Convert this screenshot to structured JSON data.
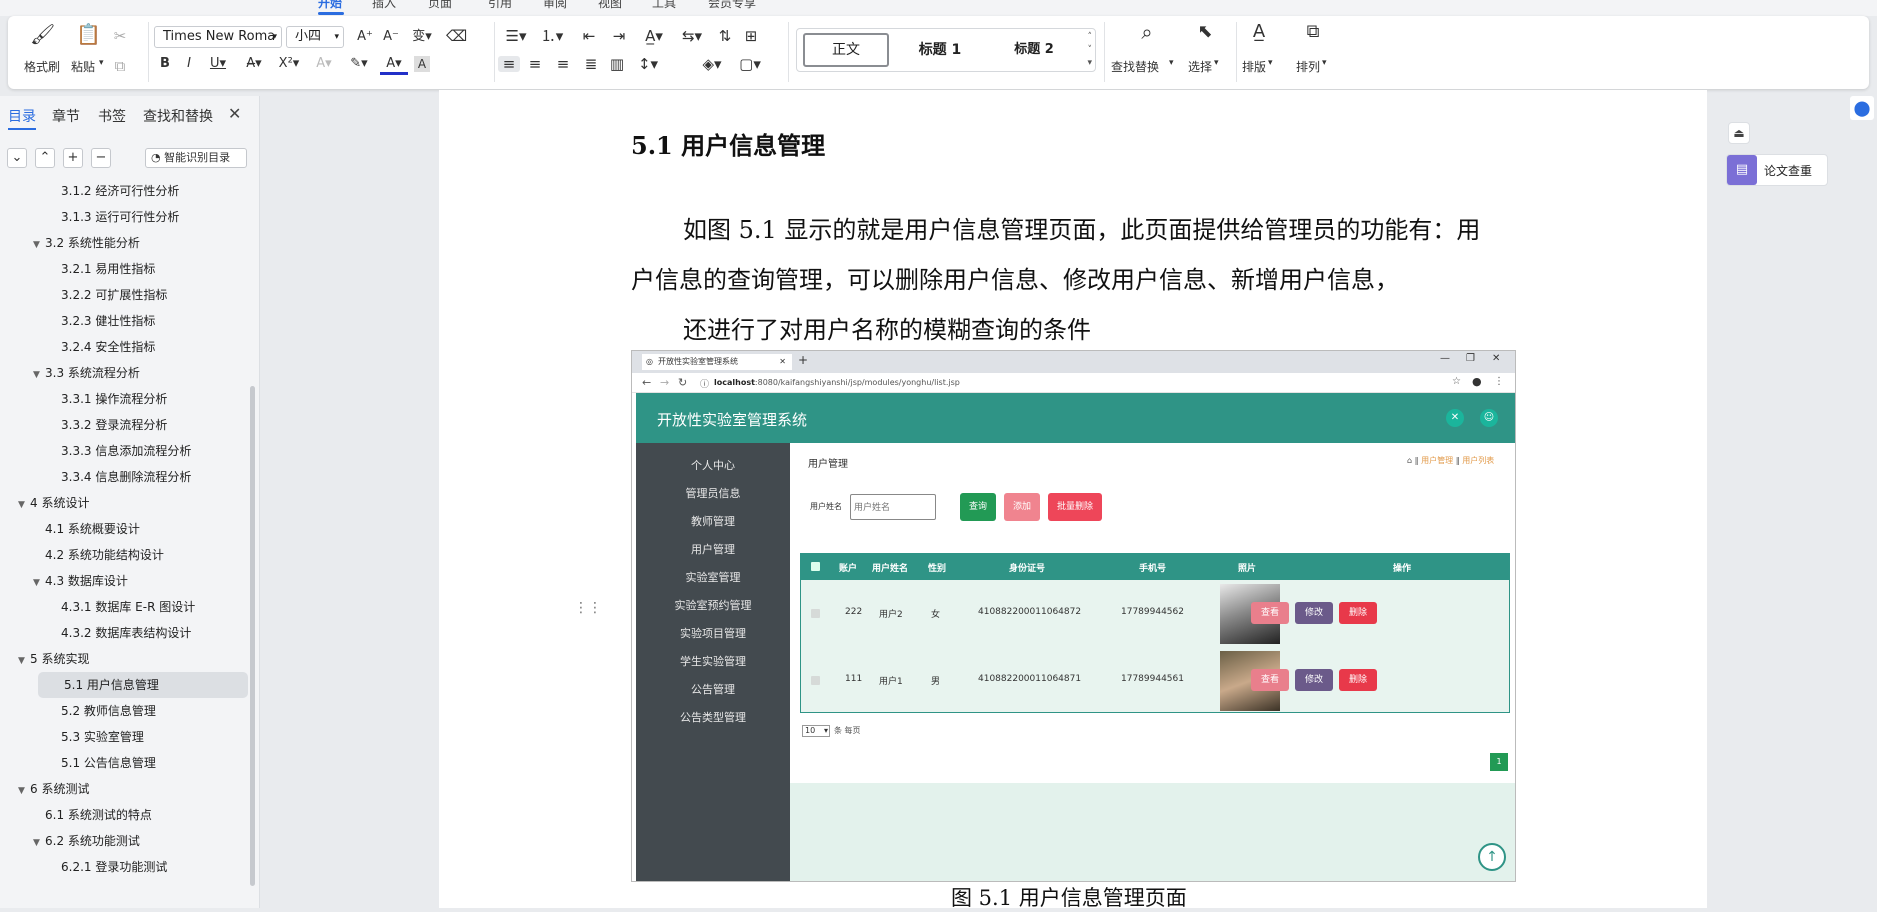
{
  "menu_tabs": [
    "开始",
    "插入",
    "页面",
    "引用",
    "审阅",
    "视图",
    "工具",
    "会员专享"
  ],
  "ribbon": {
    "format_painter": "格式刷",
    "paste": "粘贴",
    "font_name": "Times New Roma",
    "font_size": "小四",
    "style_normal": "正文",
    "style_h1": "标题 1",
    "style_h2": "标题 2",
    "find_replace": "查找替换",
    "select": "选择",
    "typeset": "排版",
    "arrange": "排列"
  },
  "sidebar": {
    "tabs": [
      "目录",
      "章节",
      "书签",
      "查找和替换"
    ],
    "smart_toc": "智能识别目录",
    "items": [
      {
        "label": "3.1.2 经济可行性分析",
        "level": 3,
        "arrow": ""
      },
      {
        "label": "3.1.3 运行可行性分析",
        "level": 3,
        "arrow": ""
      },
      {
        "label": "3.2 系统性能分析",
        "level": 2,
        "arrow": "▼"
      },
      {
        "label": "3.2.1 易用性指标",
        "level": 3,
        "arrow": ""
      },
      {
        "label": "3.2.2 可扩展性指标",
        "level": 3,
        "arrow": ""
      },
      {
        "label": "3.2.3 健壮性指标",
        "level": 3,
        "arrow": ""
      },
      {
        "label": "3.2.4 安全性指标",
        "level": 3,
        "arrow": ""
      },
      {
        "label": "3.3 系统流程分析",
        "level": 2,
        "arrow": "▼"
      },
      {
        "label": "3.3.1 操作流程分析",
        "level": 3,
        "arrow": ""
      },
      {
        "label": "3.3.2 登录流程分析",
        "level": 3,
        "arrow": ""
      },
      {
        "label": "3.3.3 信息添加流程分析",
        "level": 3,
        "arrow": ""
      },
      {
        "label": "3.3.4 信息删除流程分析",
        "level": 3,
        "arrow": ""
      },
      {
        "label": "4 系统设计",
        "level": 1,
        "arrow": "▼"
      },
      {
        "label": "4.1 系统概要设计",
        "level": 2,
        "arrow": ""
      },
      {
        "label": "4.2 系统功能结构设计",
        "level": 2,
        "arrow": ""
      },
      {
        "label": "4.3 数据库设计",
        "level": 2,
        "arrow": "▼"
      },
      {
        "label": "4.3.1 数据库 E-R 图设计",
        "level": 3,
        "arrow": ""
      },
      {
        "label": "4.3.2 数据库表结构设计",
        "level": 3,
        "arrow": ""
      },
      {
        "label": "5 系统实现",
        "level": 1,
        "arrow": "▼"
      },
      {
        "label": "5.1 用户信息管理",
        "level": 3,
        "arrow": "",
        "selected": true
      },
      {
        "label": "5.2 教师信息管理",
        "level": 3,
        "arrow": ""
      },
      {
        "label": "5.3 实验室管理",
        "level": 3,
        "arrow": ""
      },
      {
        "label": "5.1 公告信息管理",
        "level": 3,
        "arrow": ""
      },
      {
        "label": "6 系统测试",
        "level": 1,
        "arrow": "▼"
      },
      {
        "label": "6.1 系统测试的特点",
        "level": 2,
        "arrow": ""
      },
      {
        "label": "6.2 系统功能测试",
        "level": 2,
        "arrow": "▼"
      },
      {
        "label": "6.2.1 登录功能测试",
        "level": 3,
        "arrow": ""
      }
    ]
  },
  "document": {
    "heading": "5.1 用户信息管理",
    "para1": "如图 5.1 显示的就是用户信息管理页面，此页面提供给管理员的功能有：用",
    "para2": "户信息的查询管理，可以删除用户信息、修改用户信息、新增用户信息，",
    "para3": "还进行了对用户名称的模糊查询的条件",
    "caption": "图 5.1  用户信息管理页面"
  },
  "screenshot": {
    "browser_tab": "开放性实验室管理系统",
    "url_host": "localhost",
    "url_path": ":8080/kaifangshiyanshi/jsp/modules/yonghu/list.jsp",
    "app_title": "开放性实验室管理系统",
    "menu": [
      "个人中心",
      "管理员信息",
      "教师管理",
      "用户管理",
      "实验室管理",
      "实验室预约管理",
      "实验项目管理",
      "学生实验管理",
      "公告管理",
      "公告类型管理"
    ],
    "page_title": "用户管理",
    "breadcrumb_a": "用户管理",
    "breadcrumb_b": "用户列表",
    "search_label": "用户姓名",
    "search_placeholder": "用户姓名",
    "btn_query": "查询",
    "btn_add": "添加",
    "btn_batch_delete": "批量删除",
    "columns": [
      "账户",
      "用户姓名",
      "性别",
      "身份证号",
      "手机号",
      "照片",
      "操作"
    ],
    "rows": [
      {
        "account": "222",
        "name": "用户2",
        "gender": "女",
        "id_number": "410882200011064872",
        "phone": "17789944562"
      },
      {
        "account": "111",
        "name": "用户1",
        "gender": "男",
        "id_number": "410882200011064871",
        "phone": "17789944561"
      }
    ],
    "op_view": "查看",
    "op_edit": "修改",
    "op_delete": "删除",
    "page_size": "10",
    "page_size_suffix": "条 每页",
    "current_page": "1"
  },
  "right_panel": {
    "plagiarism": "论文查重"
  },
  "colors": {
    "accent": "#2b6de0",
    "app_teal": "#2f9486",
    "app_side": "#434a4f",
    "btn_pink": "#e97f8c",
    "btn_red": "#e8394a",
    "btn_purple": "#6b5a8a"
  }
}
